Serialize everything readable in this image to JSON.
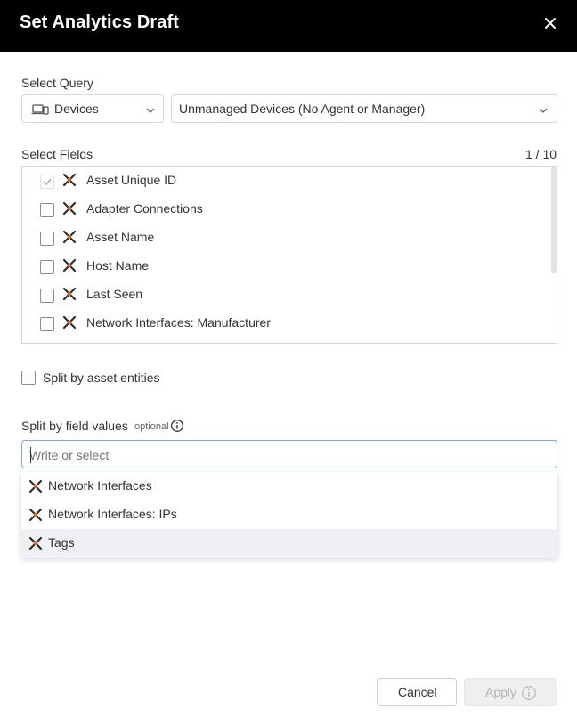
{
  "dialog": {
    "title": "Set Analytics Draft"
  },
  "select_query": {
    "label": "Select Query",
    "entity": {
      "value": "Devices",
      "icon": "devices-icon"
    },
    "query": {
      "value": "Unmanaged Devices (No Agent or Manager)"
    }
  },
  "select_fields": {
    "label": "Select Fields",
    "count": "1 / 10",
    "fields": [
      {
        "label": "Asset Unique ID",
        "checked": true,
        "disabled": true
      },
      {
        "label": "Adapter Connections",
        "checked": false
      },
      {
        "label": "Asset Name",
        "checked": false
      },
      {
        "label": "Host Name",
        "checked": false
      },
      {
        "label": "Last Seen",
        "checked": false
      },
      {
        "label": "Network Interfaces: Manufacturer",
        "checked": false
      }
    ]
  },
  "split_entities": {
    "label": "Split by asset entities",
    "checked": false
  },
  "split_field_values": {
    "label": "Split by field values",
    "optional": "optional",
    "placeholder": "Write or select",
    "options": [
      {
        "label": "Network Interfaces"
      },
      {
        "label": "Network Interfaces: IPs"
      },
      {
        "label": "Tags",
        "highlighted": true
      }
    ]
  },
  "footer": {
    "cancel_label": "Cancel",
    "apply_label": "Apply"
  },
  "colors": {
    "header_bg": "#000000",
    "adapter_icon_dark": "#2b2b2b",
    "adapter_icon_accent": "#e0662a",
    "input_focus_border": "#7fa6e0",
    "highlight_bg": "#eef0f4"
  }
}
